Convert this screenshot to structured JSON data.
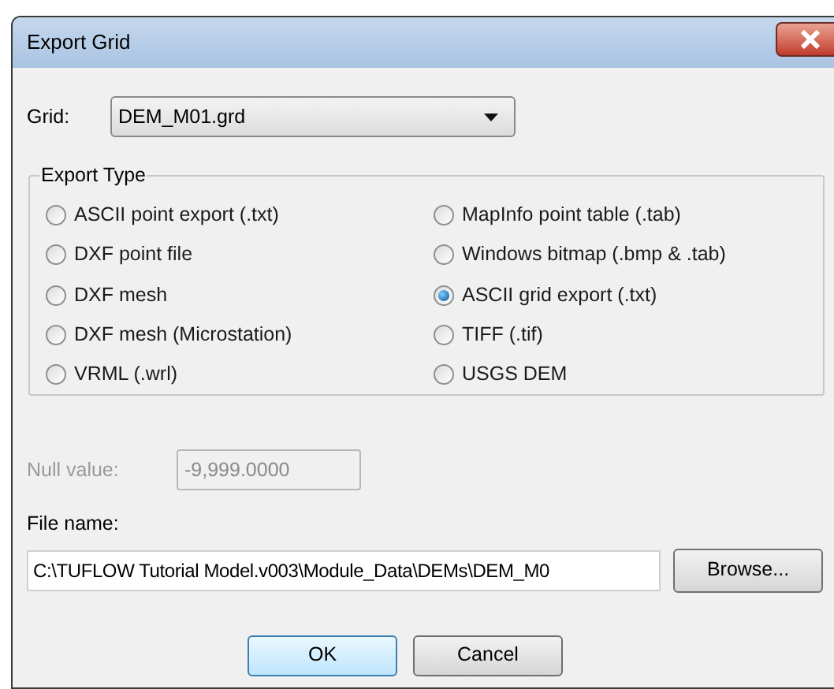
{
  "window": {
    "title": "Export Grid"
  },
  "grid": {
    "label": "Grid:",
    "value": "DEM_M01.grd"
  },
  "export_type": {
    "title": "Export Type",
    "options": [
      {
        "label": "ASCII point export (.txt)",
        "selected": false
      },
      {
        "label": "DXF point file",
        "selected": false
      },
      {
        "label": "DXF mesh",
        "selected": false
      },
      {
        "label": "DXF mesh (Microstation)",
        "selected": false
      },
      {
        "label": "VRML (.wrl)",
        "selected": false
      },
      {
        "label": "MapInfo point table (.tab)",
        "selected": false
      },
      {
        "label": "Windows bitmap (.bmp & .tab)",
        "selected": false
      },
      {
        "label": "ASCII grid export (.txt)",
        "selected": true
      },
      {
        "label": "TIFF (.tif)",
        "selected": false
      },
      {
        "label": "USGS DEM",
        "selected": false
      }
    ]
  },
  "null_value": {
    "label": "Null value:",
    "value": "-9,999.0000",
    "disabled": true
  },
  "file_name": {
    "label": "File name:",
    "value": "C:\\TUFLOW Tutorial Model.v003\\Module_Data\\DEMs\\DEM_M0"
  },
  "browse_button": "Browse...",
  "buttons": [
    {
      "label": "OK",
      "default": true
    },
    {
      "label": "Cancel",
      "default": false
    }
  ]
}
